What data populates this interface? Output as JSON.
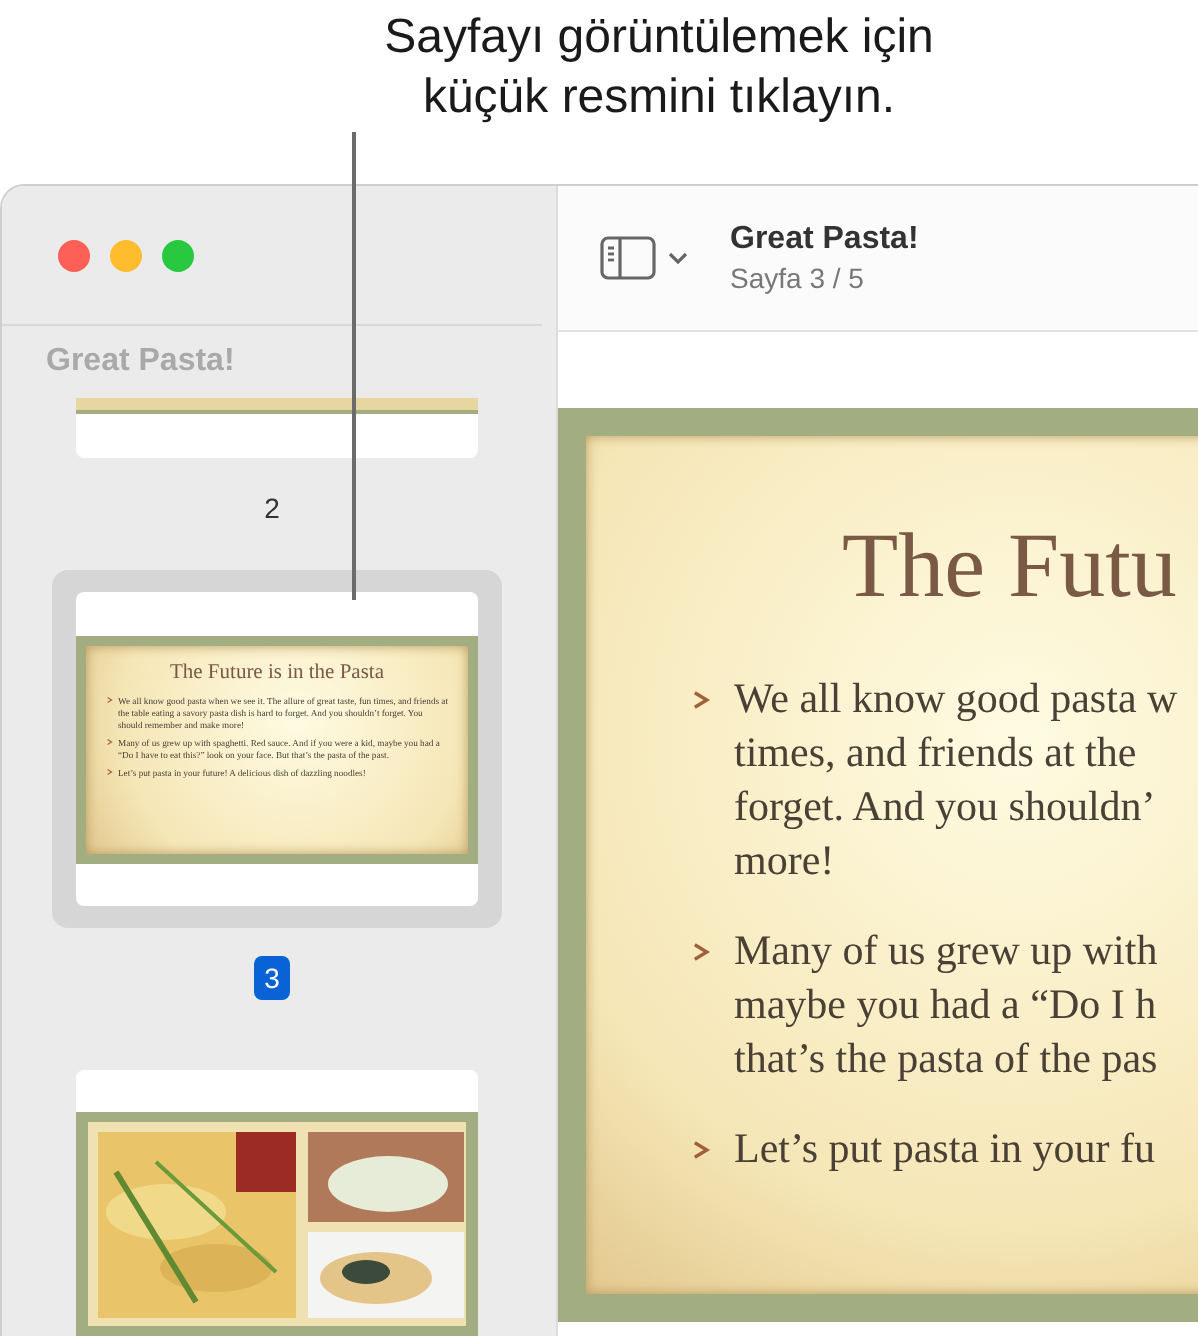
{
  "callout": {
    "text": "Sayfayı görüntülemek için\nküçük resmini tıklayın."
  },
  "window": {
    "title": "Great Pasta!",
    "subtitle": "Sayfa 3 / 5"
  },
  "sidebar": {
    "heading": "Great Pasta!",
    "thumbnails": [
      {
        "kind": "slice",
        "label": "2",
        "selected": false
      },
      {
        "kind": "text",
        "label": "3",
        "selected": true,
        "title": "The Future is in the Pasta",
        "bullets": [
          "We all know good pasta when we see it. The allure of great taste, fun times, and friends at the table eating a savory pasta dish is hard to forget. And you shouldn’t forget. You should remember and make more!",
          "Many of us grew up with spaghetti. Red sauce. And if you were a kid, maybe you had a “Do I have to eat this?” look on your face. But that’s the pasta of the past.",
          "Let’s put pasta in your future! A delicious dish of dazzling noodles!"
        ]
      },
      {
        "kind": "picture",
        "selected": false
      }
    ]
  },
  "slide": {
    "title": "The Futu",
    "bullets": [
      [
        "We all know good pasta w",
        "times, and friends at the",
        "forget. And you shouldn’",
        "more!"
      ],
      [
        "Many of us grew up with",
        "maybe you had a “Do I h",
        "that’s the pasta of the pas"
      ],
      [
        "Let’s put pasta in your fu"
      ]
    ]
  }
}
